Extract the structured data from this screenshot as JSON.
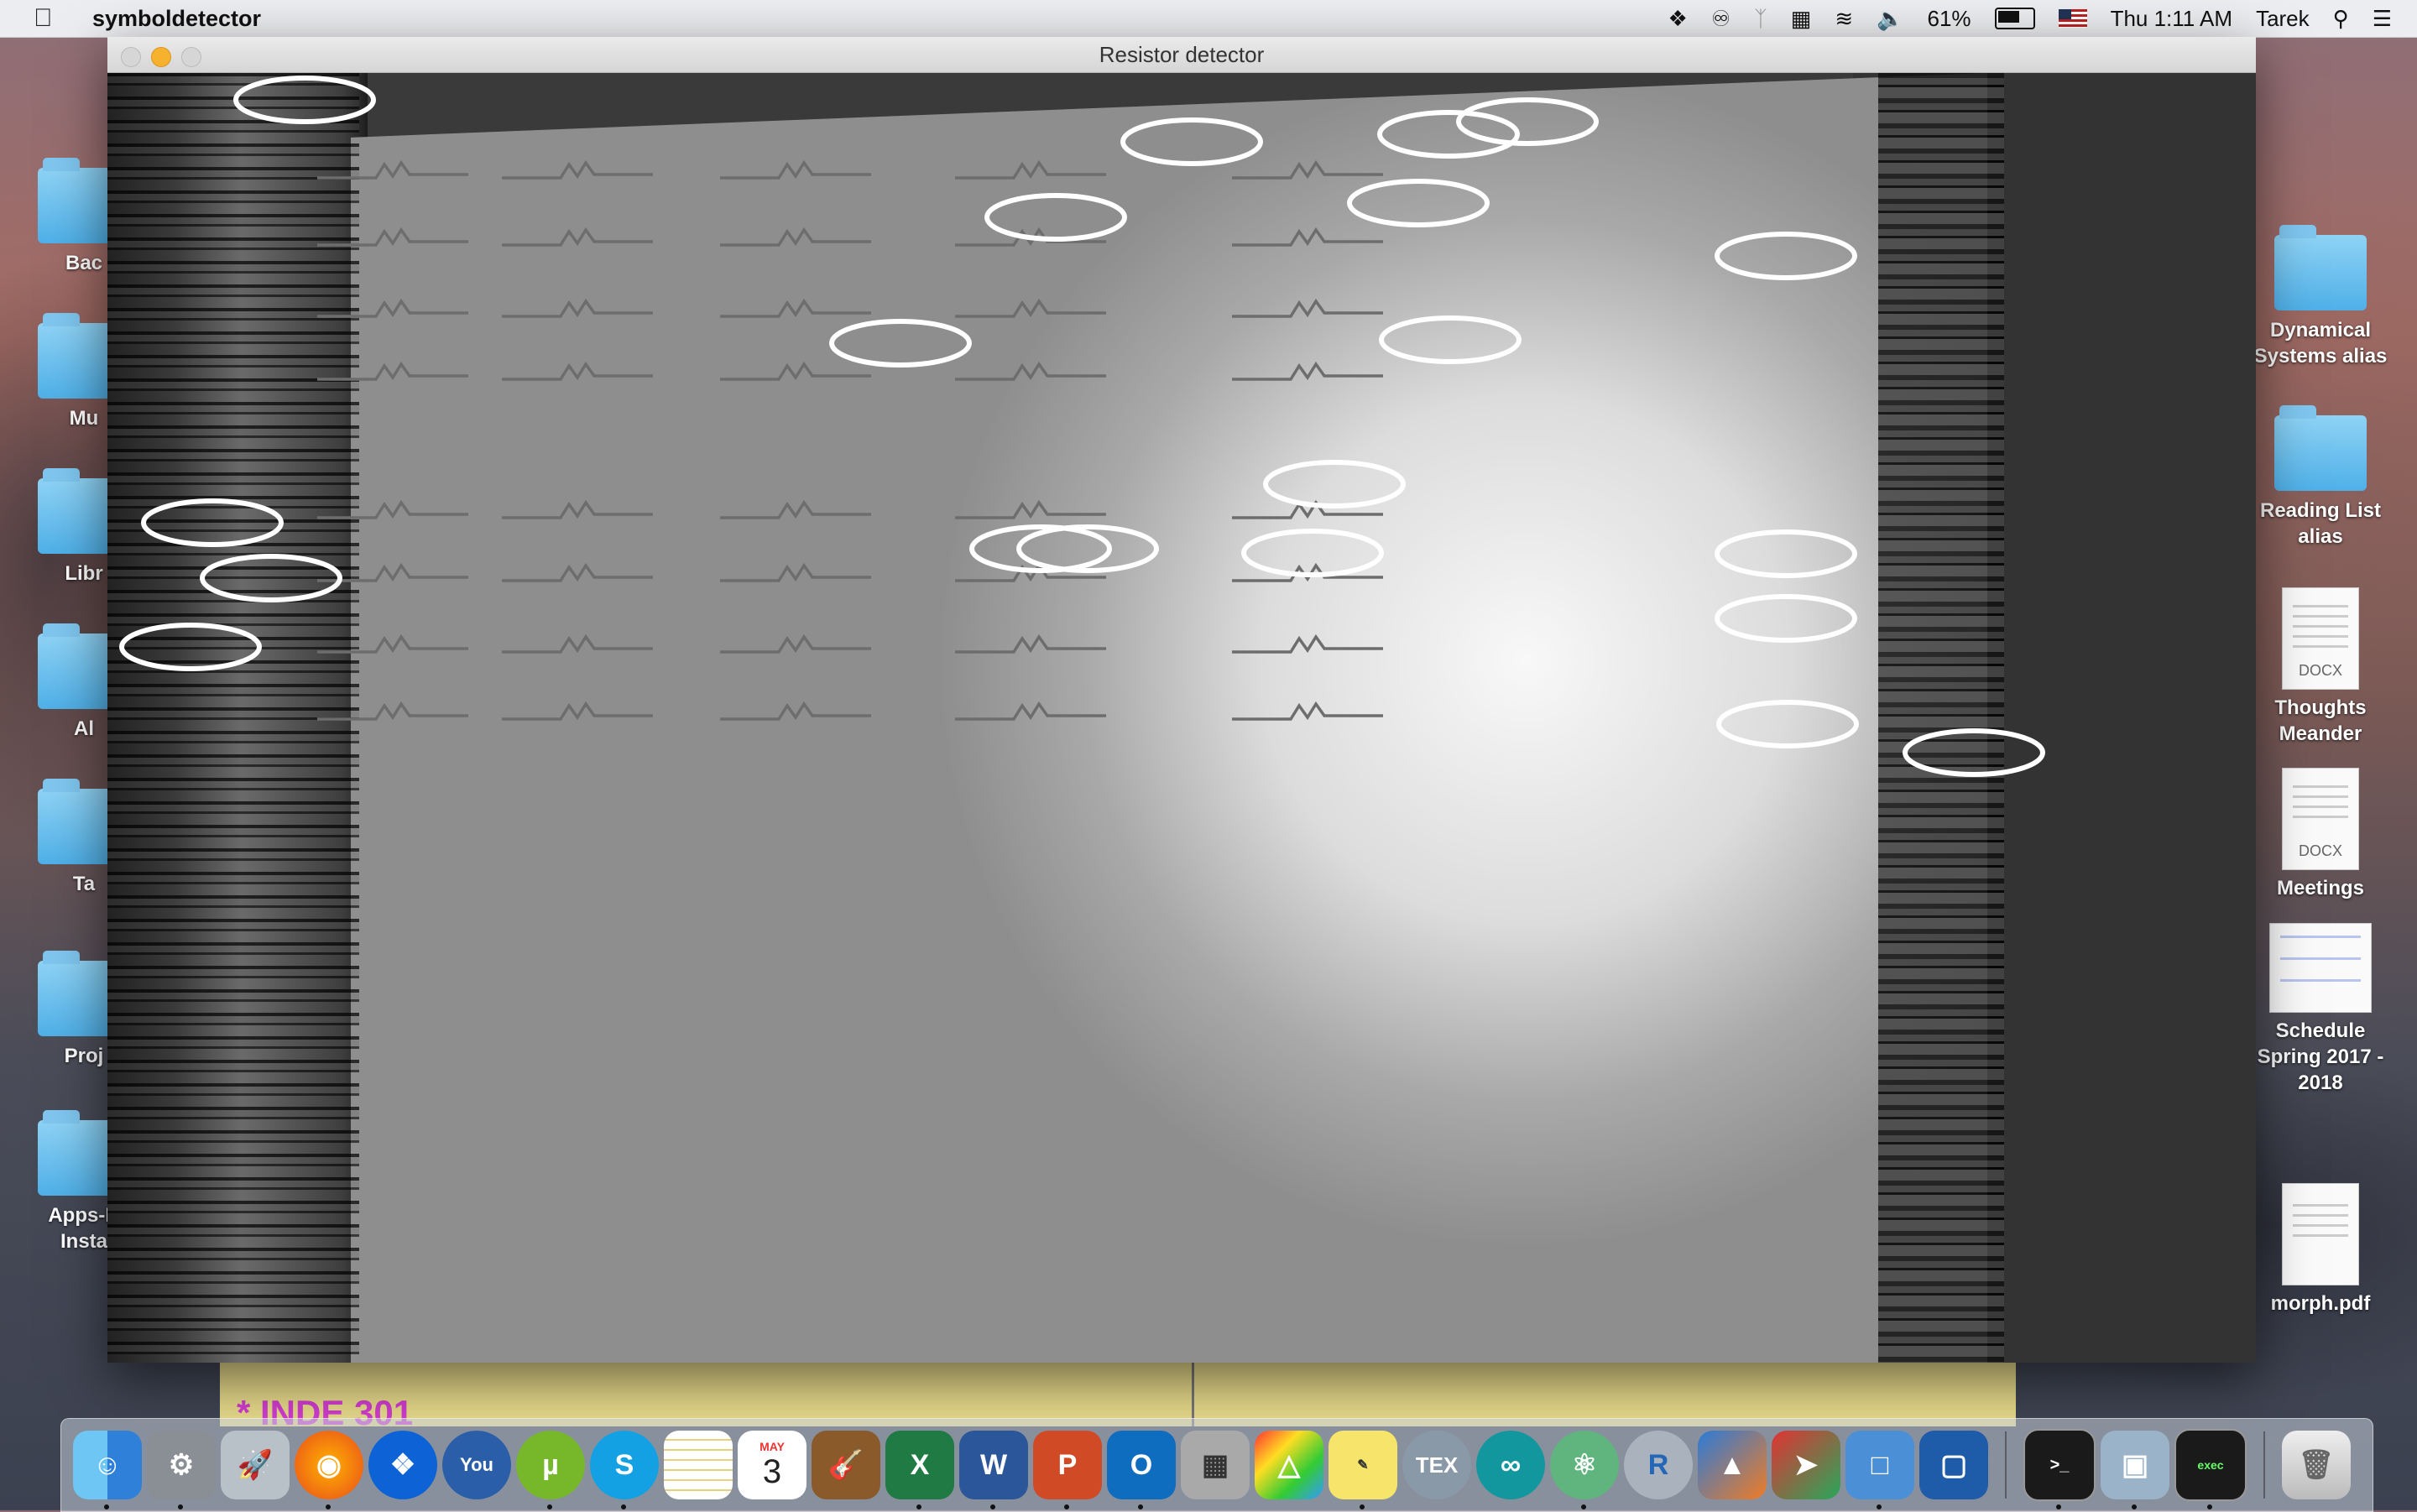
{
  "menubar": {
    "app_name": "symboldetector",
    "battery": "61%",
    "clock": "Thu 1:11 AM",
    "user": "Tarek"
  },
  "window": {
    "title": "Resistor detector"
  },
  "desktop_left": [
    {
      "label": "Bac"
    },
    {
      "label": "Mu"
    },
    {
      "label": "Libr"
    },
    {
      "label": "Al"
    },
    {
      "label": "Ta"
    },
    {
      "label": "Proj"
    },
    {
      "label": "Apps-D Insta"
    }
  ],
  "desktop_right": [
    {
      "label": "Dynamical Systems alias",
      "kind": "folder-alias"
    },
    {
      "label": "Reading List alias",
      "kind": "folder-alias"
    },
    {
      "label": "Thoughts Meander",
      "kind": "docx",
      "tag": "DOCX"
    },
    {
      "label": "Meetings",
      "kind": "docx",
      "tag": "DOCX"
    },
    {
      "label": "Schedule Spring 2017 - 2018",
      "kind": "image"
    },
    {
      "label": "morph.pdf",
      "kind": "pdf"
    }
  ],
  "background_note": "* INDE 301",
  "dock": {
    "calendar_month": "MAY",
    "calendar_day": "3",
    "apps": [
      "finder-icon",
      "system-preferences-icon",
      "launchpad-icon",
      "firefox-icon",
      "dropbox-icon",
      "youtube-icon",
      "utorrent-icon",
      "skype-icon",
      "notes-icon",
      "calendar-icon",
      "garageband-icon",
      "excel-icon",
      "word-icon",
      "powerpoint-icon",
      "outlook-icon",
      "calculator-icon",
      "grapher-icon",
      "stickies-icon",
      "tex-icon",
      "arduino-icon",
      "atom-icon",
      "r-icon",
      "matlab-icon",
      "airmail-icon",
      "parallels-icon",
      "virtualbox-icon",
      "terminal-icon",
      "preview-icon",
      "exec-icon",
      "trash-icon"
    ]
  },
  "colors": {
    "traffic_yellow": "#f6b12f",
    "detection_ellipse": "#ffffff"
  }
}
